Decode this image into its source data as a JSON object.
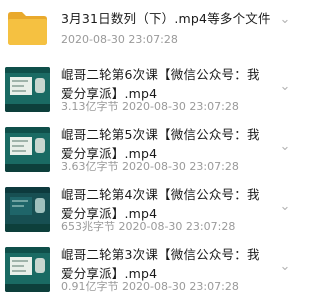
{
  "items": [
    {
      "kind": "folder",
      "title": "3月31日数列（下）.mp4等多个文件",
      "meta": "2020-08-30 23:07:28",
      "icon": "folder-icon"
    },
    {
      "kind": "video",
      "title": "崐哥二轮第6次课【微信公众号：我爱分享派】.mp4",
      "meta": "3.13亿字节 2020-08-30 23:07:28",
      "icon": "video-thumbnail"
    },
    {
      "kind": "video",
      "title": "崐哥二轮第5次课【微信公众号：我爱分享派】.mp4",
      "meta": "3.63亿字节 2020-08-30 23:07:28",
      "icon": "video-thumbnail"
    },
    {
      "kind": "video",
      "title": "崐哥二轮第4次课【微信公众号：我爱分享派】.mp4",
      "meta": "653兆字节 2020-08-30 23:07:28",
      "icon": "video-thumbnail"
    },
    {
      "kind": "video",
      "title": "崐哥二轮第3次课【微信公众号：我爱分享派】.mp4",
      "meta": "0.91亿字节 2020-08-30 23:07:28",
      "icon": "video-thumbnail"
    }
  ],
  "more_icon": "chevron-down-icon",
  "colors": {
    "folder": "#f5c141",
    "folder_dark": "#e9a92c",
    "thumb": "#1a6a63"
  }
}
